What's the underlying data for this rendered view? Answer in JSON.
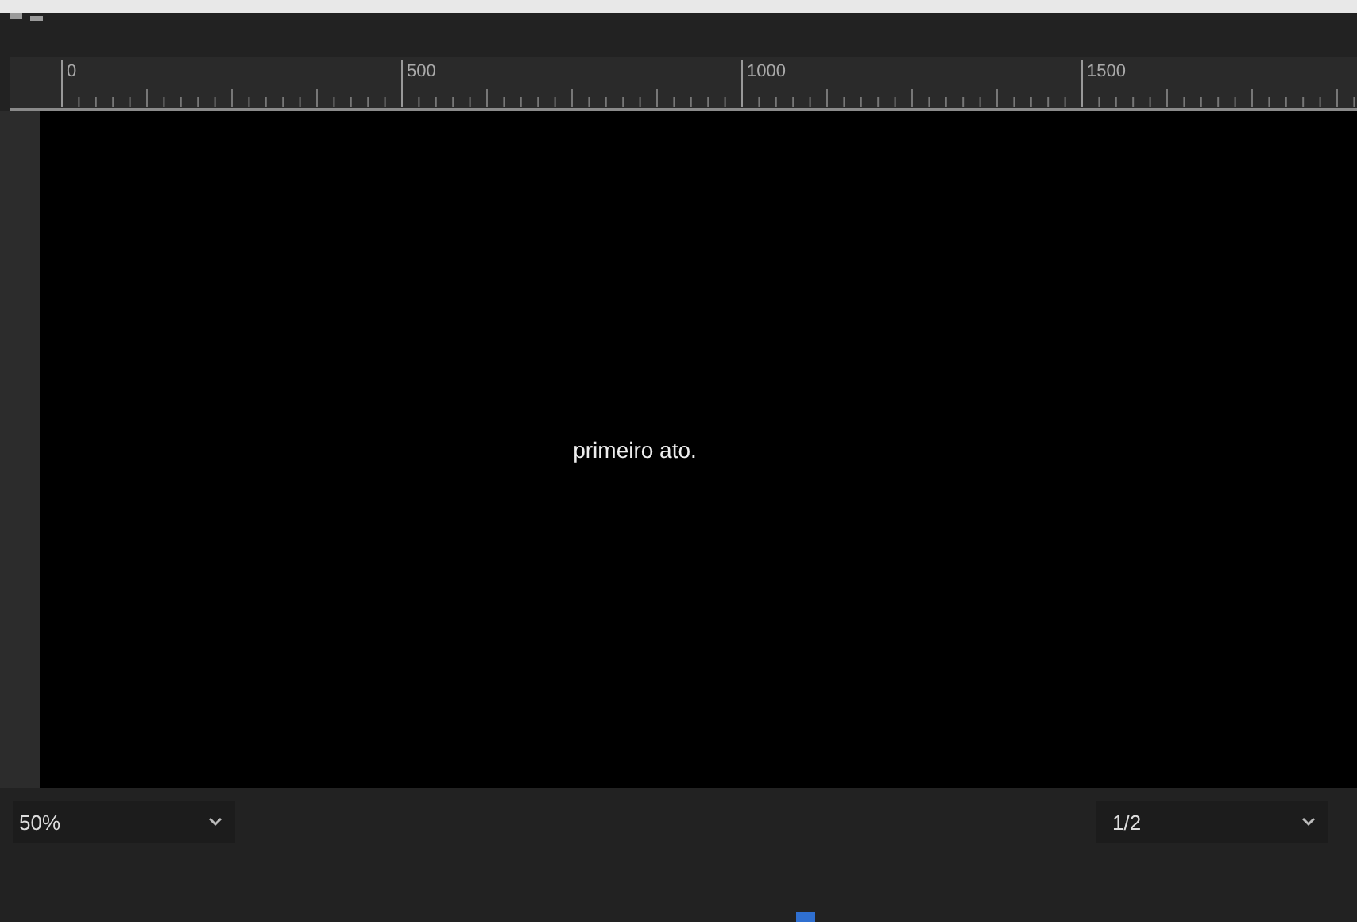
{
  "ruler": {
    "labels": [
      "0",
      "500",
      "1000",
      "1500"
    ]
  },
  "canvas": {
    "caption": "primeiro ato."
  },
  "zoom_dropdown": {
    "value": "50%"
  },
  "resolution_dropdown": {
    "value": "1/2"
  }
}
